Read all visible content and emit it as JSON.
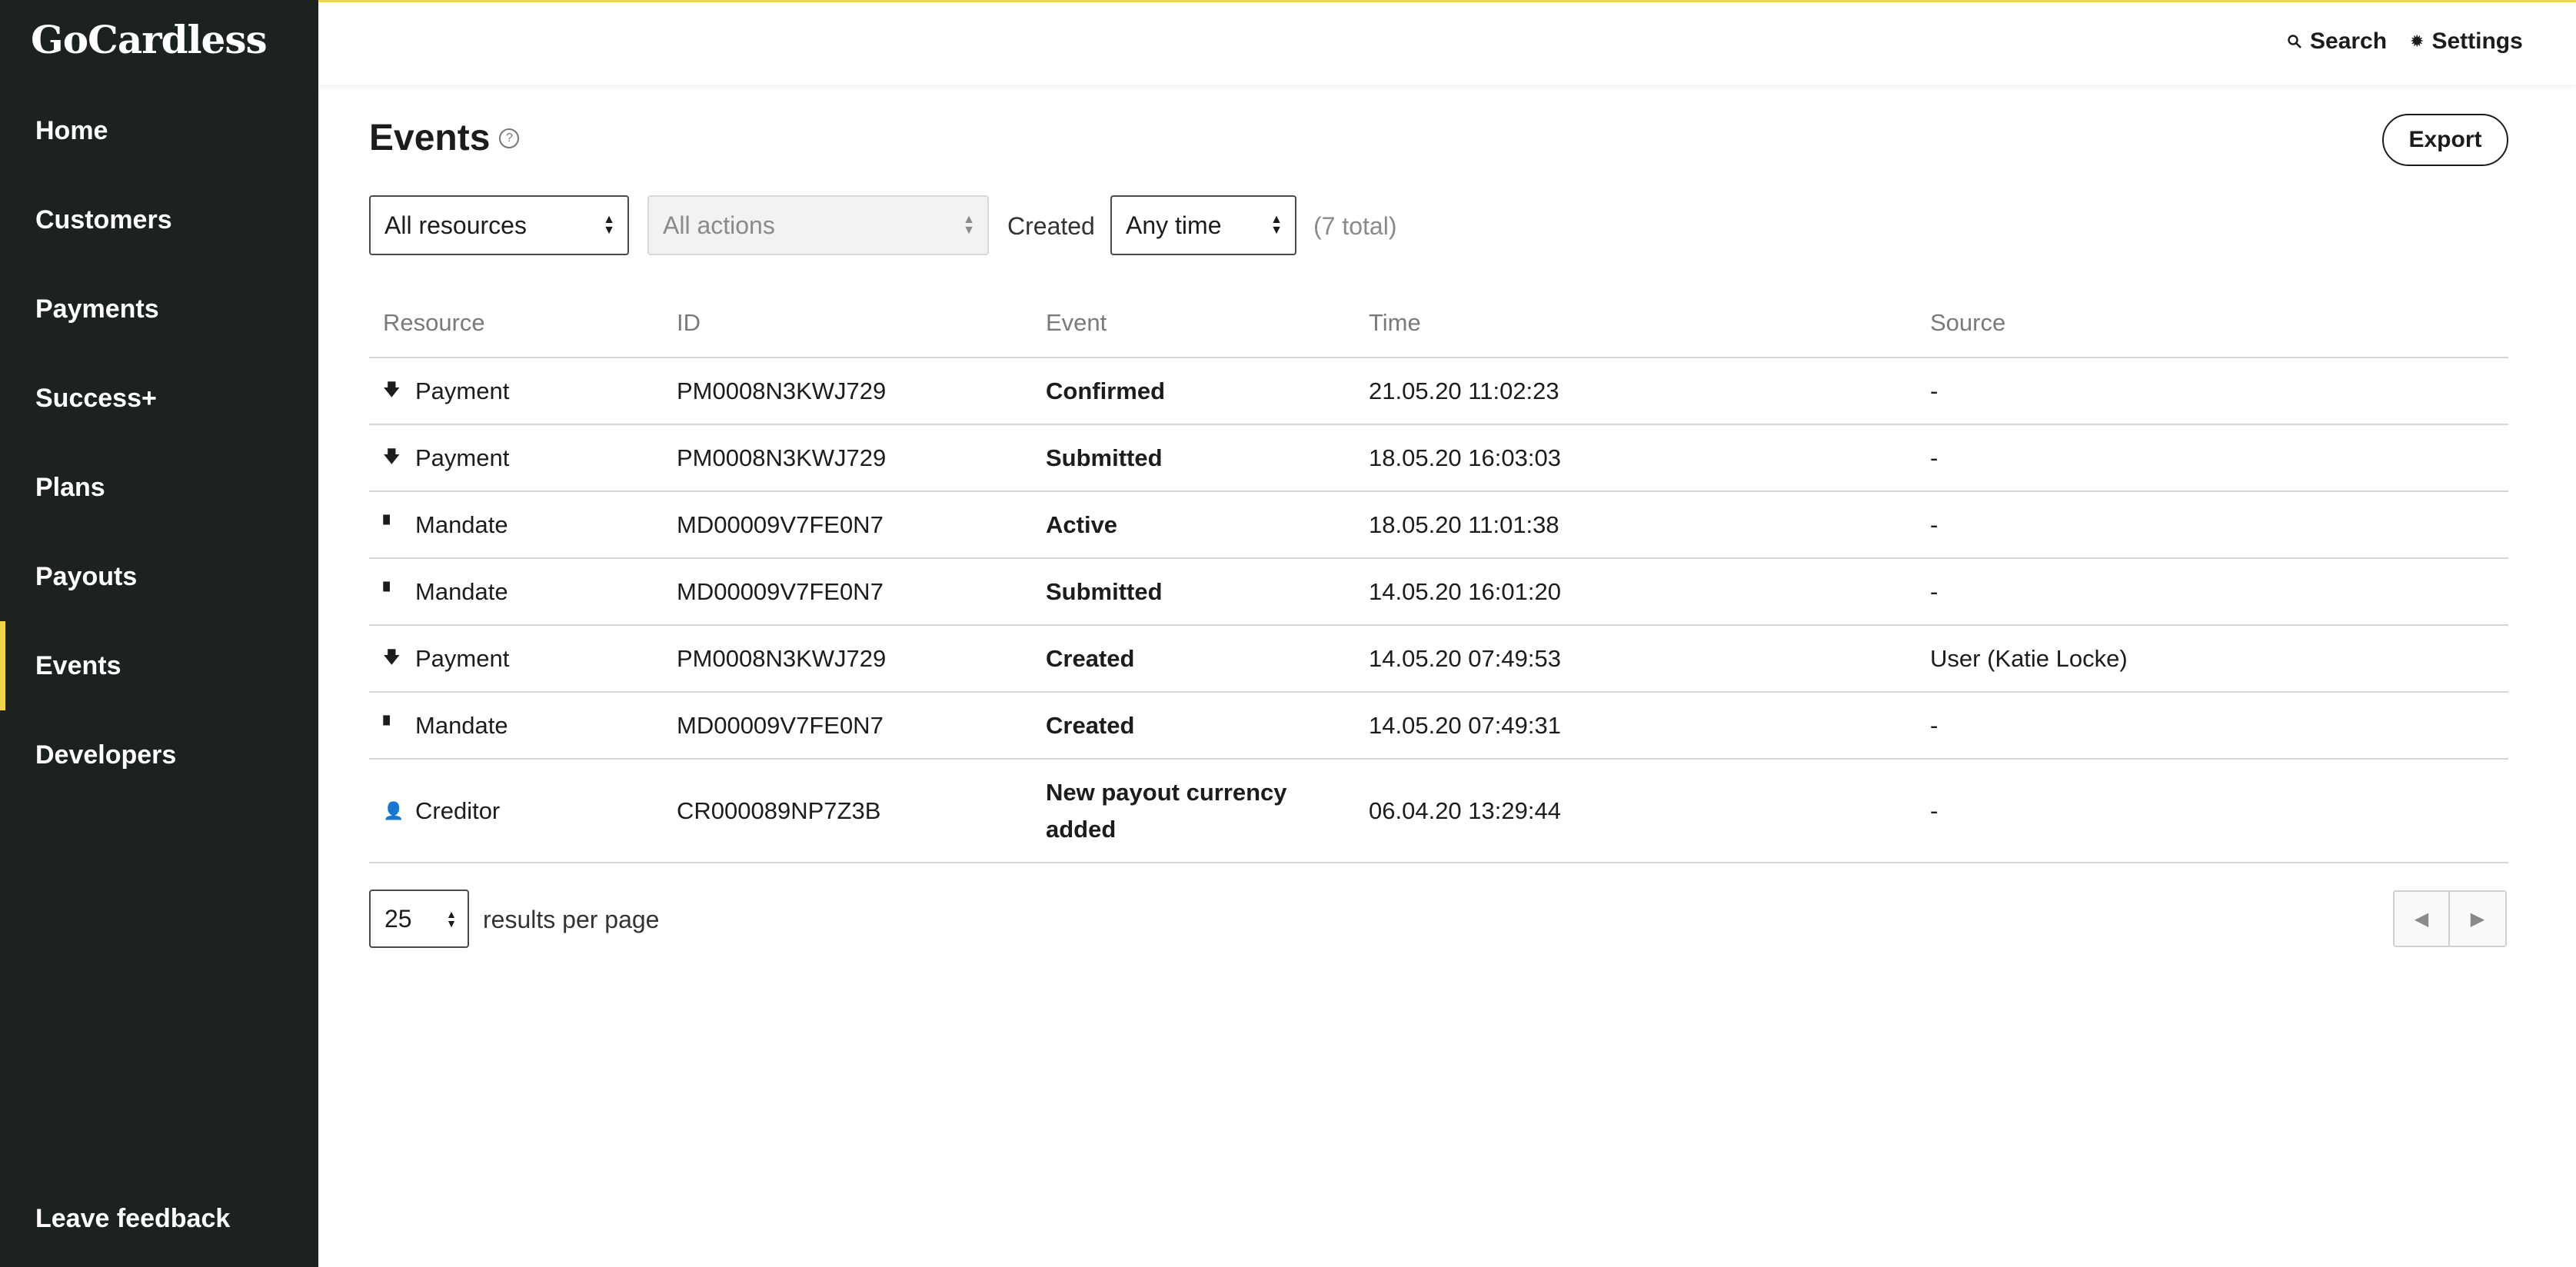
{
  "brand": {
    "logo": "GoCardless",
    "accent": "#f1d64a",
    "sidebar_bg": "#1c2220"
  },
  "sidebar": {
    "items": [
      {
        "label": "Home"
      },
      {
        "label": "Customers"
      },
      {
        "label": "Payments"
      },
      {
        "label": "Success+"
      },
      {
        "label": "Plans"
      },
      {
        "label": "Payouts"
      },
      {
        "label": "Events",
        "active": true
      },
      {
        "label": "Developers"
      }
    ],
    "feedback": "Leave feedback"
  },
  "topbar": {
    "search": "Search",
    "settings": "Settings",
    "search_icon": "search-icon",
    "settings_icon": "gear-icon"
  },
  "page": {
    "title": "Events",
    "help_icon": "help-circle-icon",
    "export": "Export"
  },
  "filters": {
    "resource": "All resources",
    "action": "All actions",
    "created_label": "Created",
    "created": "Any time",
    "total": "(7 total)"
  },
  "table": {
    "headers": {
      "resource": "Resource",
      "id": "ID",
      "event": "Event",
      "time": "Time",
      "source": "Source"
    },
    "rows": [
      {
        "icon": "arrow-down-icon",
        "resource": "Payment",
        "id": "PM0008N3KWJ729",
        "event": "Confirmed",
        "time": "21.05.20 11:02:23",
        "source": "-"
      },
      {
        "icon": "arrow-down-icon",
        "resource": "Payment",
        "id": "PM0008N3KWJ729",
        "event": "Submitted",
        "time": "18.05.20 16:03:03",
        "source": "-"
      },
      {
        "icon": "document-icon",
        "resource": "Mandate",
        "id": "MD00009V7FE0N7",
        "event": "Active",
        "time": "18.05.20 11:01:38",
        "source": "-"
      },
      {
        "icon": "document-icon",
        "resource": "Mandate",
        "id": "MD00009V7FE0N7",
        "event": "Submitted",
        "time": "14.05.20 16:01:20",
        "source": "-"
      },
      {
        "icon": "arrow-down-icon",
        "resource": "Payment",
        "id": "PM0008N3KWJ729",
        "event": "Created",
        "time": "14.05.20 07:49:53",
        "source": "User (Katie Locke)"
      },
      {
        "icon": "document-icon",
        "resource": "Mandate",
        "id": "MD00009V7FE0N7",
        "event": "Created",
        "time": "14.05.20 07:49:31",
        "source": "-"
      },
      {
        "icon": "person-icon",
        "resource": "Creditor",
        "id": "CR000089NP7Z3B",
        "event": "New payout currency added",
        "time": "06.04.20 13:29:44",
        "source": "-"
      }
    ]
  },
  "pagination": {
    "per_page": "25",
    "per_page_label": "results per page"
  }
}
